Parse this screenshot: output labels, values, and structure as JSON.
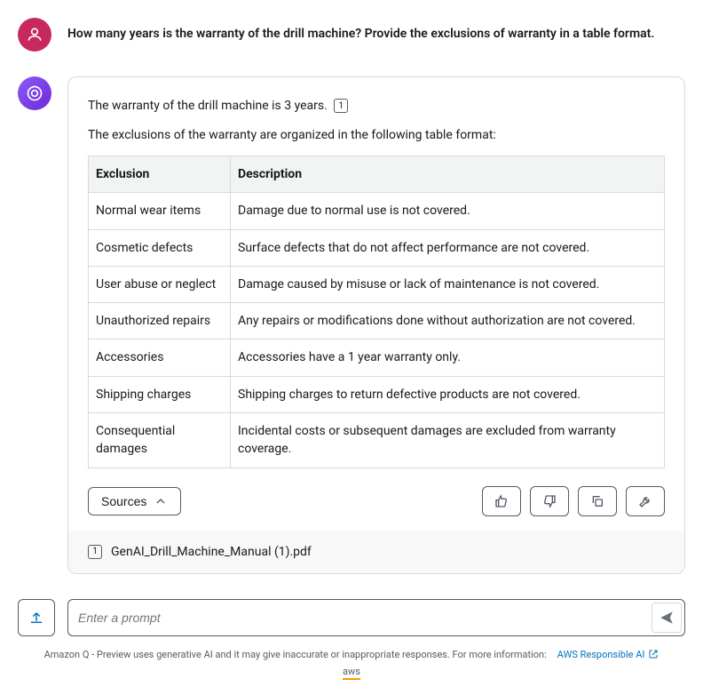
{
  "user": {
    "question": "How many years is the warranty of the drill machine? Provide the exclusions of warranty in a table format."
  },
  "bot": {
    "line1": "The warranty of the drill machine is 3 years.",
    "citation1": "1",
    "line2": "The exclusions of the warranty are organized in the following table format:",
    "table": {
      "headers": {
        "c1": "Exclusion",
        "c2": "Description"
      },
      "rows": [
        {
          "exclusion": "Normal wear items",
          "description": "Damage due to normal use is not covered."
        },
        {
          "exclusion": "Cosmetic defects",
          "description": "Surface defects that do not affect performance are not covered."
        },
        {
          "exclusion": "User abuse or neglect",
          "description": "Damage caused by misuse or lack of maintenance is not covered."
        },
        {
          "exclusion": "Unauthorized repairs",
          "description": "Any repairs or modifications done without authorization are not covered."
        },
        {
          "exclusion": "Accessories",
          "description": "Accessories have a 1 year warranty only."
        },
        {
          "exclusion": "Shipping charges",
          "description": "Shipping charges to return defective products are not covered."
        },
        {
          "exclusion": "Consequential damages",
          "description": "Incidental costs or subsequent damages are excluded from warranty coverage."
        }
      ]
    },
    "sources_label": "Sources",
    "source1": {
      "num": "1",
      "name": "GenAI_Drill_Machine_Manual (1).pdf"
    }
  },
  "input": {
    "placeholder": "Enter a prompt"
  },
  "footer": {
    "disclaimer": "Amazon Q - Preview uses generative AI and it may give inaccurate or inappropriate responses. For more information:",
    "link_label": "AWS Responsible AI",
    "logo": "aws"
  }
}
